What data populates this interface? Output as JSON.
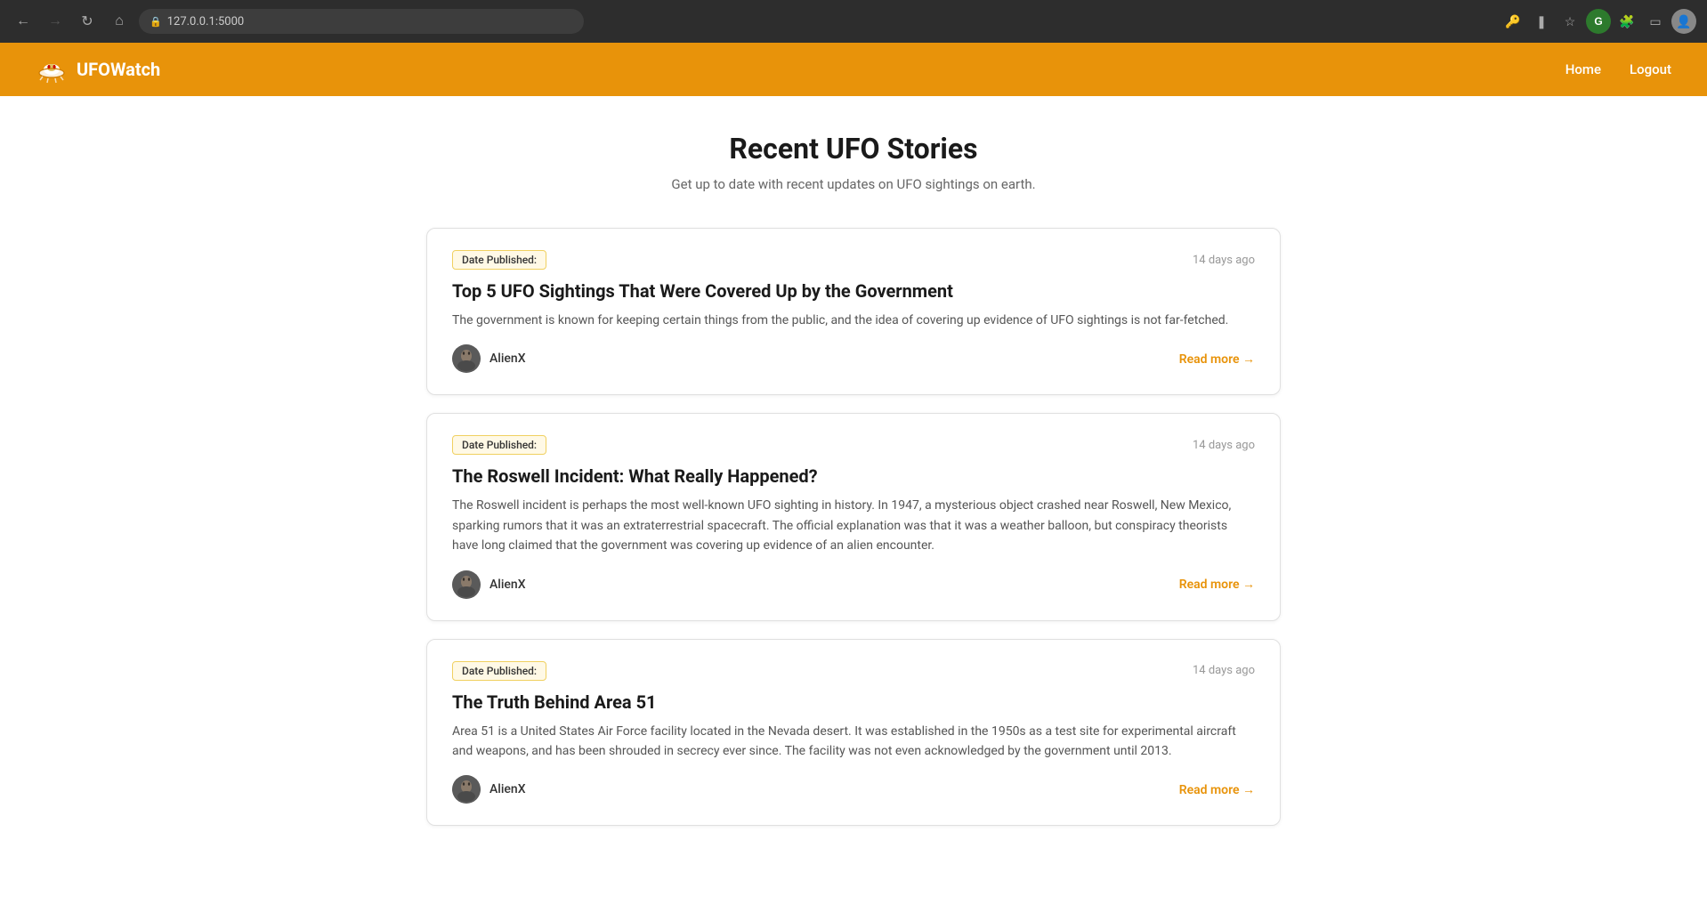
{
  "browser": {
    "url": "127.0.0.1:5000",
    "back_disabled": false,
    "forward_disabled": true
  },
  "navbar": {
    "brand_name": "UFOWatch",
    "links": [
      {
        "label": "Home",
        "href": "#"
      },
      {
        "label": "Logout",
        "href": "#"
      }
    ]
  },
  "page": {
    "title": "Recent UFO Stories",
    "subtitle": "Get up to date with recent updates on UFO sightings on earth."
  },
  "stories": [
    {
      "id": 1,
      "date_label": "Date Published:",
      "time_ago": "14 days ago",
      "title": "Top 5 UFO Sightings That Were Covered Up by the Government",
      "excerpt": "The government is known for keeping certain things from the public, and the idea of covering up evidence of UFO sightings is not far-fetched.",
      "author": "AlienX",
      "read_more": "Read more"
    },
    {
      "id": 2,
      "date_label": "Date Published:",
      "time_ago": "14 days ago",
      "title": "The Roswell Incident: What Really Happened?",
      "excerpt": "The Roswell incident is perhaps the most well-known UFO sighting in history. In 1947, a mysterious object crashed near Roswell, New Mexico, sparking rumors that it was an extraterrestrial spacecraft. The official explanation was that it was a weather balloon, but conspiracy theorists have long claimed that the government was covering up evidence of an alien encounter.",
      "author": "AlienX",
      "read_more": "Read more"
    },
    {
      "id": 3,
      "date_label": "Date Published:",
      "time_ago": "14 days ago",
      "title": "The Truth Behind Area 51",
      "excerpt": "Area 51 is a United States Air Force facility located in the Nevada desert. It was established in the 1950s as a test site for experimental aircraft and weapons, and has been shrouded in secrecy ever since. The facility was not even acknowledged by the government until 2013.",
      "author": "AlienX",
      "read_more": "Read more"
    }
  ],
  "colors": {
    "accent": "#e8930a",
    "navbar_bg": "#e8930a"
  }
}
